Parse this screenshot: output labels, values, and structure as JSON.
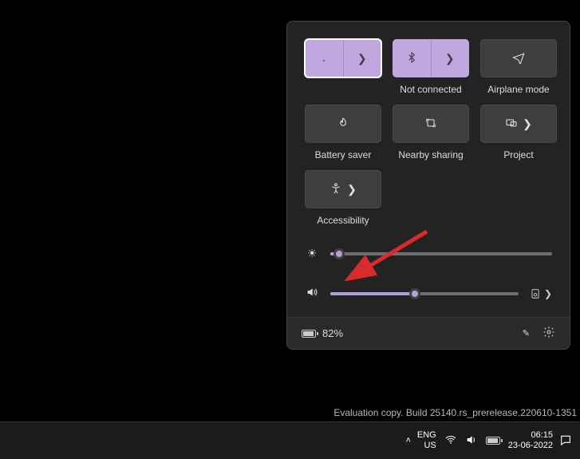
{
  "tiles": {
    "wifi": {
      "label": ""
    },
    "bluetooth": {
      "label": "Not connected"
    },
    "airplane": {
      "label": "Airplane mode"
    },
    "battery_saver": {
      "label": "Battery saver"
    },
    "nearby": {
      "label": "Nearby sharing"
    },
    "project": {
      "label": "Project"
    },
    "accessibility": {
      "label": "Accessibility"
    }
  },
  "sliders": {
    "brightness": {
      "value": 4
    },
    "volume": {
      "value": 45
    }
  },
  "footer": {
    "battery_text": "82%"
  },
  "watermark": "Evaluation copy. Build 25140.rs_prerelease.220610-1351",
  "taskbar": {
    "lang1": "ENG",
    "lang2": "US",
    "time": "06:15",
    "date": "23-06-2022"
  }
}
